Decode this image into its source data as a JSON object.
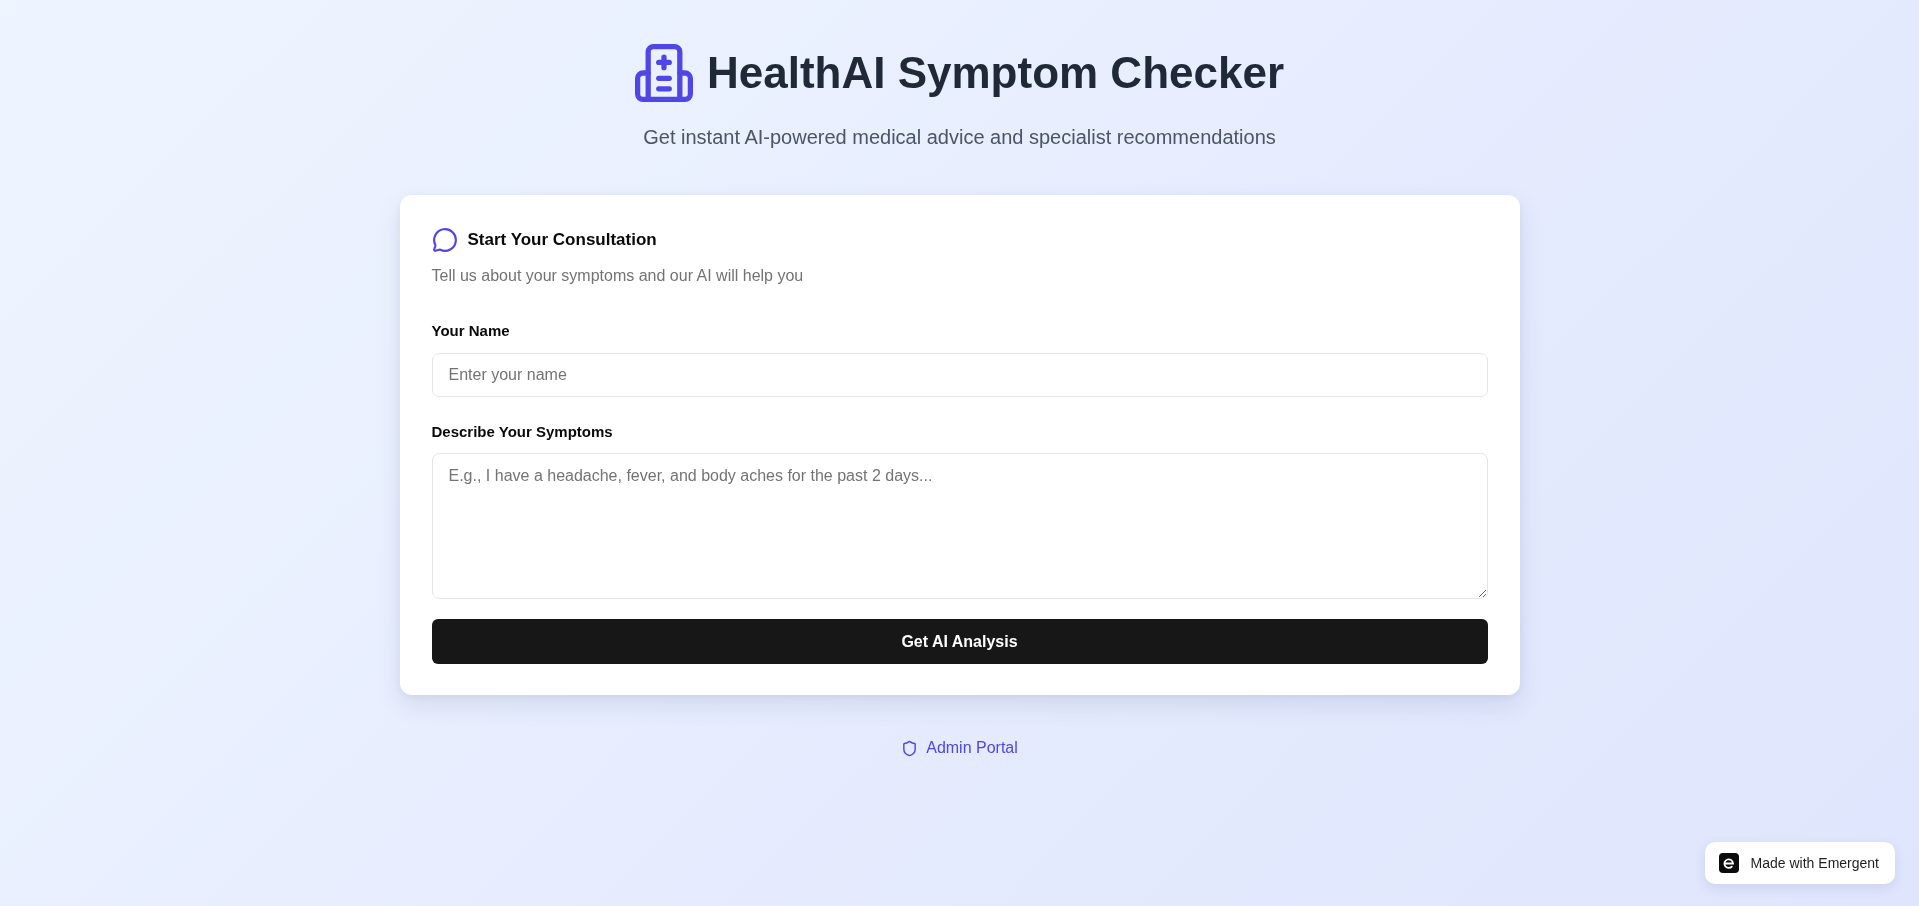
{
  "header": {
    "title": "HealthAI Symptom Checker",
    "subtitle": "Get instant AI-powered medical advice and specialist recommendations"
  },
  "consultation_card": {
    "title": "Start Your Consultation",
    "description": "Tell us about your symptoms and our AI will help you",
    "fields": [
      {
        "kind": "input",
        "label": "Your Name",
        "placeholder": "Enter your name"
      },
      {
        "kind": "textarea",
        "label": "Describe Your Symptoms",
        "placeholder": "E.g., I have a headache, fever, and body aches for the past 2 days..."
      }
    ],
    "submit_button": "Get AI Analysis"
  },
  "admin_link": "Admin Portal",
  "badge": "Made with Emergent"
}
